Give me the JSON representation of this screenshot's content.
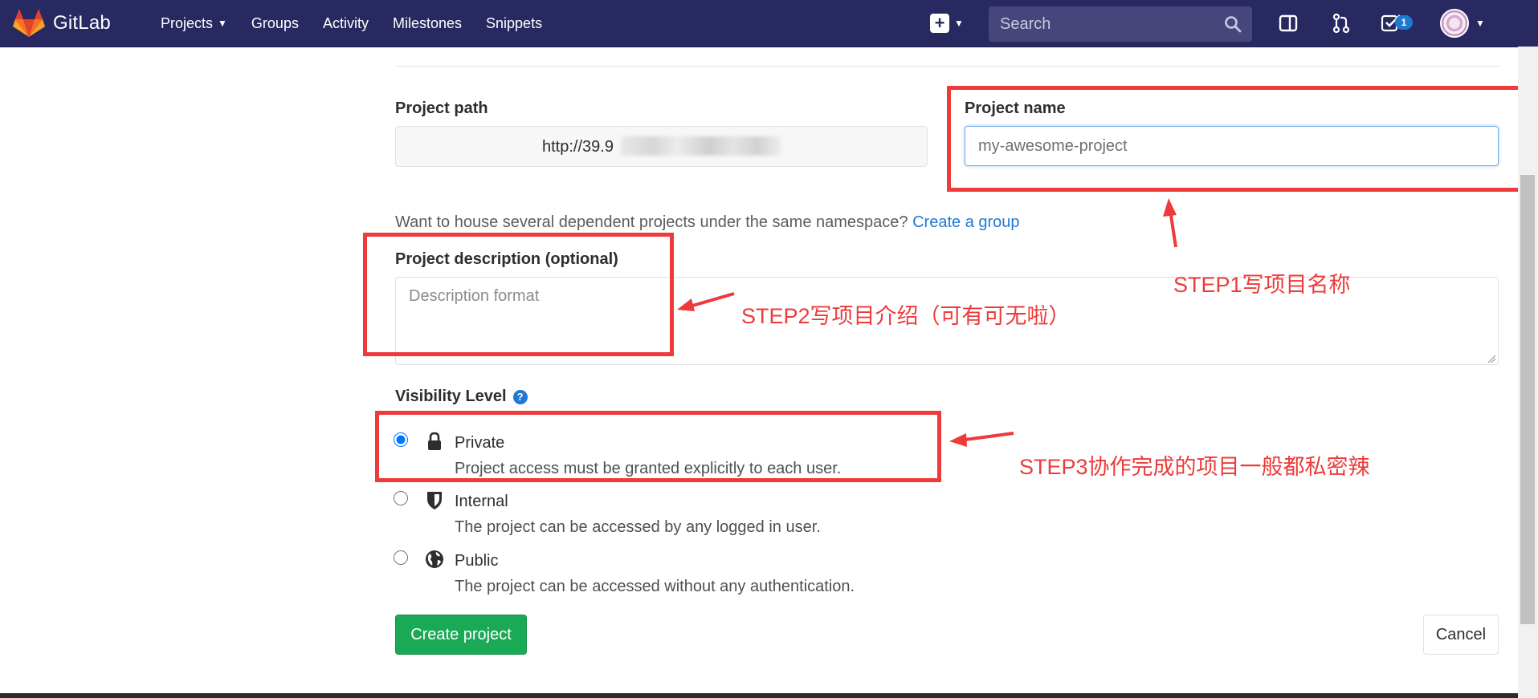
{
  "navbar": {
    "brand": "GitLab",
    "links": [
      {
        "label": "Projects",
        "has_caret": true
      },
      {
        "label": "Groups",
        "has_caret": false
      },
      {
        "label": "Activity",
        "has_caret": false
      },
      {
        "label": "Milestones",
        "has_caret": false
      },
      {
        "label": "Snippets",
        "has_caret": false
      }
    ],
    "search_placeholder": "Search",
    "todo_count": "1",
    "icons": [
      "plus-icon",
      "search-icon",
      "sidebar-toggle-icon",
      "merge-request-icon",
      "todo-check-icon"
    ],
    "bg_color": "#292961"
  },
  "form": {
    "project_path_label": "Project path",
    "project_path_value": "http://39.9",
    "project_name_label": "Project name",
    "project_name_placeholder": "my-awesome-project",
    "help_text": "Want to house several dependent projects under the same namespace?",
    "create_group_link": "Create a group",
    "description_label": "Project description (optional)",
    "description_placeholder": "Description format",
    "visibility_label": "Visibility Level",
    "visibility_options": [
      {
        "title": "Private",
        "desc": "Project access must be granted explicitly to each user.",
        "icon": "lock-icon",
        "checked": true
      },
      {
        "title": "Internal",
        "desc": "The project can be accessed by any logged in user.",
        "icon": "shield-icon",
        "checked": false
      },
      {
        "title": "Public",
        "desc": "The project can be accessed without any authentication.",
        "icon": "globe-icon",
        "checked": false
      }
    ],
    "create_button": "Create project",
    "cancel_button": "Cancel"
  },
  "annotations": {
    "step1": "STEP1写项目名称",
    "step2": "STEP2写项目介绍（可有可无啦）",
    "step3": "STEP3协作完成的项目一般都私密辣",
    "color": "#ee3a3a"
  },
  "colors": {
    "accent_link": "#1f78d1",
    "create_button": "#1aaa55"
  }
}
